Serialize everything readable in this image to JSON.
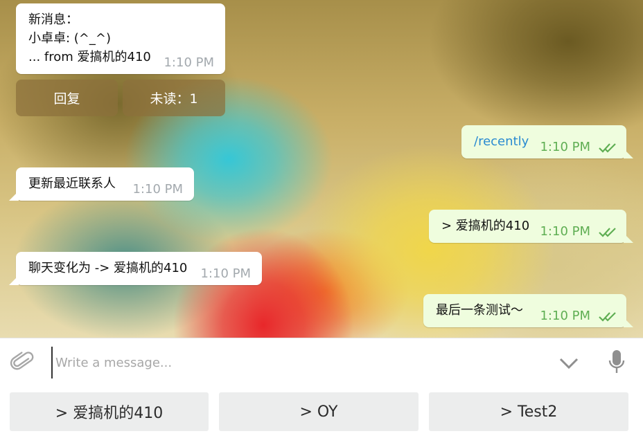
{
  "messages": {
    "notice": {
      "line1": "新消息：",
      "line2": "小卓卓: (^_^)",
      "line3": "... from 爱搞机的410",
      "time": "1:10 PM"
    },
    "inline_buttons": {
      "reply": "回复",
      "unread": "未读：1"
    },
    "out1": {
      "text": "/recently",
      "time": "1:10 PM"
    },
    "in2": {
      "text": "更新最近联系人",
      "time": "1:10 PM"
    },
    "out2": {
      "text": "> 爱搞机的410",
      "time": "1:10 PM"
    },
    "in3": {
      "text": "聊天变化为 -> 爱搞机的410",
      "time": "1:10 PM"
    },
    "out3": {
      "text": "最后一条测试～",
      "time": "1:10 PM"
    }
  },
  "composer": {
    "placeholder": "Write a message..."
  },
  "keyboard": {
    "buttons": [
      "> 爱搞机的410",
      "> OY",
      "> Test2"
    ]
  },
  "colors": {
    "link": "#2a8bd1",
    "time_out": "#5fae53",
    "time_in": "#a3a9ae",
    "out_bubble": "#effdde"
  },
  "icons": {
    "attach": "paperclip-icon",
    "dropdown": "chevron-down-icon",
    "mic": "microphone-icon",
    "read": "double-check-icon"
  }
}
